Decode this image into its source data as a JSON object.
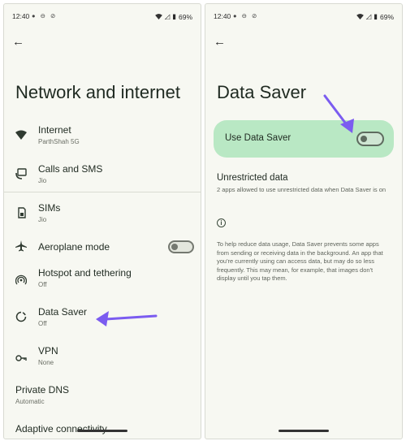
{
  "status_bar": {
    "time": "12:40",
    "battery": "69%"
  },
  "left_screen": {
    "title": "Network and internet",
    "items": [
      {
        "title": "Internet",
        "subtitle": "ParthShah 5G",
        "icon": "wifi-icon"
      },
      {
        "title": "Calls and SMS",
        "subtitle": "Jio",
        "icon": "calls-sms-icon"
      },
      {
        "title": "SIMs",
        "subtitle": "Jio",
        "icon": "sim-icon"
      },
      {
        "title": "Aeroplane mode",
        "subtitle": "",
        "icon": "airplane-icon"
      },
      {
        "title": "Hotspot and tethering",
        "subtitle": "Off",
        "icon": "hotspot-icon"
      },
      {
        "title": "Data Saver",
        "subtitle": "Off",
        "icon": "data-saver-icon"
      },
      {
        "title": "VPN",
        "subtitle": "None",
        "icon": "vpn-key-icon"
      },
      {
        "title": "Private DNS",
        "subtitle": "Automatic",
        "icon": ""
      },
      {
        "title": "Adaptive connectivity",
        "subtitle": "",
        "icon": ""
      }
    ]
  },
  "right_screen": {
    "title": "Data Saver",
    "use_label": "Use Data Saver",
    "unrestricted_title": "Unrestricted data",
    "unrestricted_desc": "2 apps allowed to use unrestricted data when Data Saver is on",
    "info_text": "To help reduce data usage, Data Saver prevents some apps from sending or receiving data in the background. An app that you're currently using can access data, but may do so less frequently. This may mean, for example, that images don't display until you tap them."
  },
  "colors": {
    "annotation_arrow": "#7b5cf0",
    "toggle_card": "#b9e8c4"
  }
}
